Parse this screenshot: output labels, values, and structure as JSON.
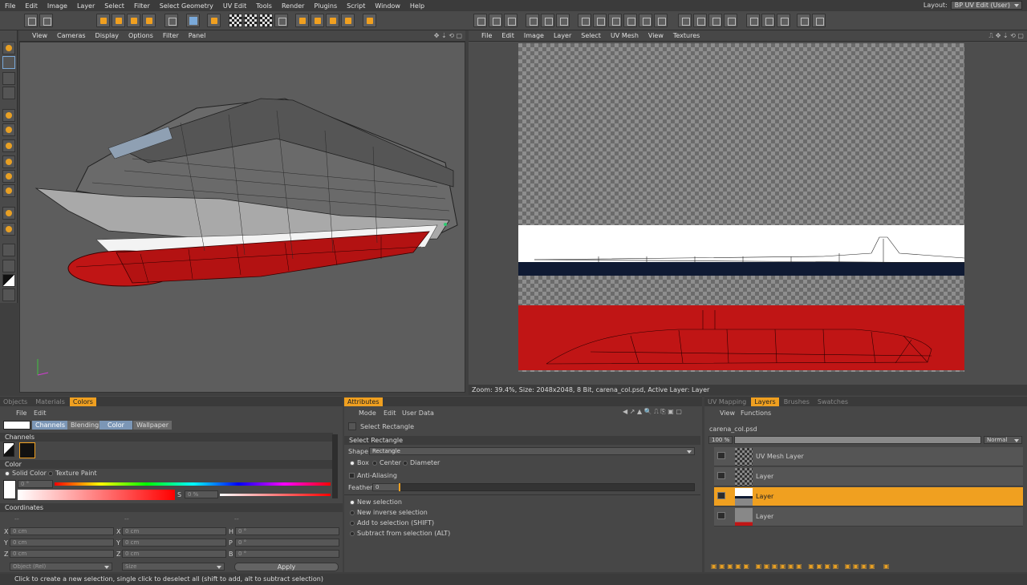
{
  "menu": [
    "File",
    "Edit",
    "Image",
    "Layer",
    "Select",
    "Filter",
    "Select Geometry",
    "UV Edit",
    "Tools",
    "Render",
    "Plugins",
    "Script",
    "Window",
    "Help"
  ],
  "layout": {
    "label": "Layout:",
    "value": "BP UV Edit (User)"
  },
  "viewport3d": {
    "menu": [
      "View",
      "Cameras",
      "Display",
      "Options",
      "Filter",
      "Panel"
    ]
  },
  "viewportUV": {
    "menu": [
      "File",
      "Edit",
      "Image",
      "Layer",
      "Select",
      "UV Mesh",
      "View",
      "Textures"
    ],
    "status": "Zoom: 39.4%, Size: 2048x2048, 8 Bit, carena_col.psd, Active Layer: Layer"
  },
  "colors_panel": {
    "tabs": [
      "Objects",
      "Materials",
      "Colors"
    ],
    "active_tab": "Colors",
    "menu": [
      "File",
      "Edit"
    ],
    "mode_tabs": [
      "Channels",
      "Blending",
      "Color",
      "Wallpaper"
    ],
    "channels_header": "Channels",
    "color_header": "Color",
    "solid_color": "Solid Color",
    "texture_paint": "Texture Paint",
    "hue_value": "0 °",
    "s_label": "S",
    "s_value": "0 %",
    "coordinates_header": "Coordinates",
    "coord_headers": [
      "--",
      "--",
      "--"
    ],
    "coords": [
      {
        "a": "X",
        "av": "0 cm",
        "b": "X",
        "bv": "0 cm",
        "c": "H",
        "cv": "0 °"
      },
      {
        "a": "Y",
        "av": "0 cm",
        "b": "Y",
        "bv": "0 cm",
        "c": "P",
        "cv": "0 °"
      },
      {
        "a": "Z",
        "av": "0 cm",
        "b": "Z",
        "bv": "0 cm",
        "c": "B",
        "cv": "0 °"
      }
    ],
    "object_mode": "Object (Rel)",
    "size_mode": "Size",
    "apply": "Apply"
  },
  "attributes": {
    "tab": "Attributes",
    "menu": [
      "Mode",
      "Edit",
      "User Data"
    ],
    "tool_title": "Select Rectangle",
    "section": "Select Rectangle",
    "shape_label": "Shape",
    "shape_value": "Rectangle",
    "shape_options": [
      "Box",
      "Center",
      "Diameter"
    ],
    "anti_aliasing": "Anti-Aliasing",
    "feather_label": "Feather",
    "feather_value": "0",
    "selection_modes": [
      "New selection",
      "New inverse selection",
      "Add to selection (SHIFT)",
      "Subtract from selection (ALT)"
    ]
  },
  "layers_panel": {
    "tabs": [
      "UV Mapping",
      "Layers",
      "Brushes",
      "Swatches"
    ],
    "active_tab": "Layers",
    "menu": [
      "View",
      "Functions"
    ],
    "file": "carena_col.psd",
    "opacity": "100 %",
    "blend_mode": "Normal",
    "layers": [
      {
        "name": "UV Mesh Layer",
        "active": false
      },
      {
        "name": "Layer",
        "active": false
      },
      {
        "name": "Layer",
        "active": true
      },
      {
        "name": "Layer",
        "active": false
      }
    ]
  },
  "status_bar": "Click to create a new selection, single click to deselect all (shift to add, alt to subtract selection)",
  "colors": {
    "accent": "#f0a020",
    "hull_red": "#c01515",
    "navy": "#0f1a33"
  }
}
